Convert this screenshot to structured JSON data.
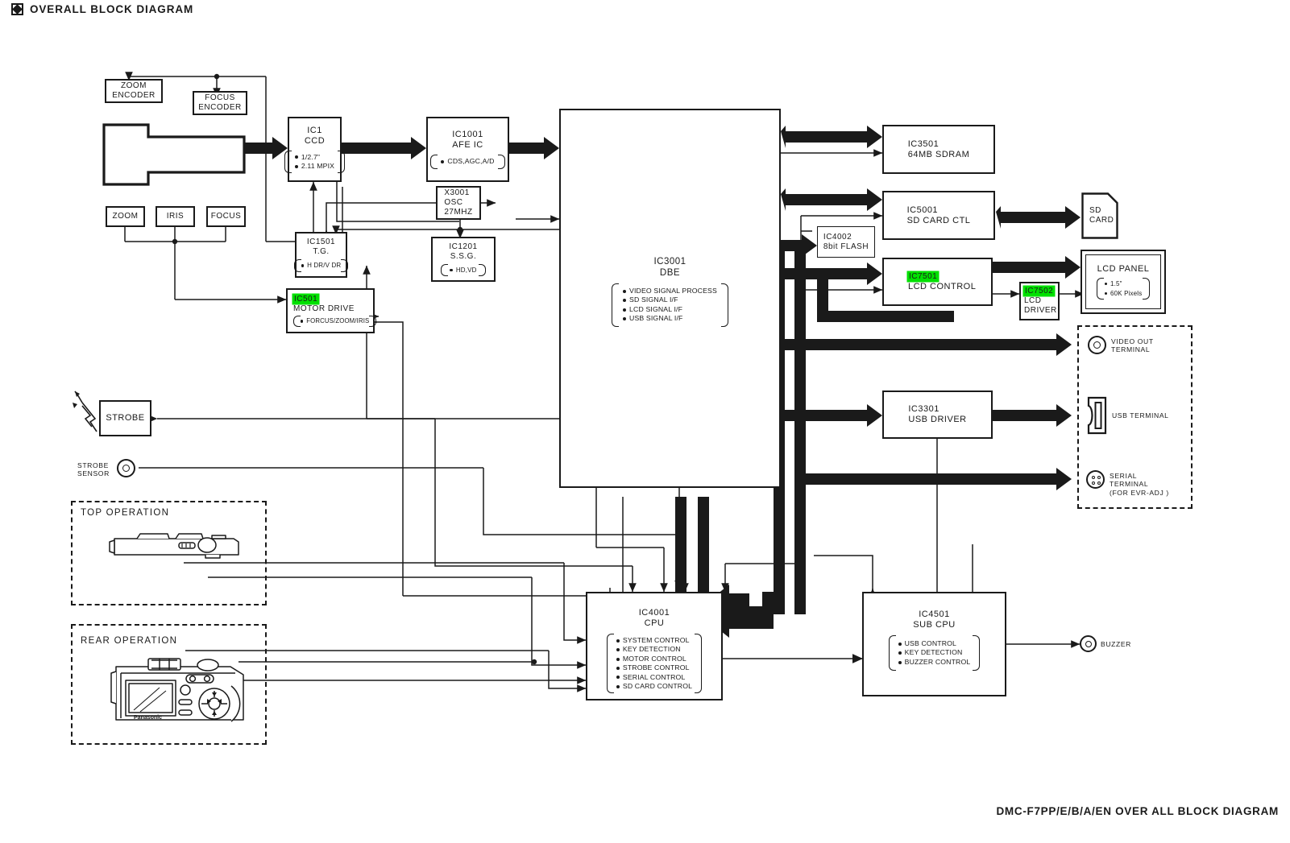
{
  "header": {
    "title": "OVERALL BLOCK DIAGRAM",
    "icon": "diamond-bullet-icon"
  },
  "footer": {
    "text": "DMC-F7PP/E/B/A/EN OVER ALL BLOCK DIAGRAM"
  },
  "colors": {
    "ink": "#1a1a1a",
    "highlight": "#00e000",
    "background": "#ffffff"
  },
  "blocks": {
    "zoom_encoder": {
      "title": "ZOOM\nENCODER"
    },
    "focus_encoder": {
      "title": "FOCUS\nENCODER"
    },
    "zoom_motor": {
      "title": "ZOOM"
    },
    "iris_motor": {
      "title": "IRIS"
    },
    "focus_motor": {
      "title": "FOCUS"
    },
    "ic1_ccd": {
      "id": "IC1",
      "name": "CCD",
      "bullets": [
        "1/2.7\"",
        "2.11 MPIX"
      ]
    },
    "ic1001_afe": {
      "id": "IC1001",
      "name": "AFE IC",
      "bullets": [
        "CDS,AGC,A/D"
      ]
    },
    "x3001_osc": {
      "title": "X3001\nOSC\n27MHZ"
    },
    "ic1501_tg": {
      "id": "IC1501",
      "name": "T.G.",
      "bullets": [
        "H DR/V DR"
      ]
    },
    "ic1201_ssg": {
      "id": "IC1201",
      "name": "S.S.G.",
      "bullets": [
        "HD,VD"
      ]
    },
    "ic501_motor": {
      "id": "IC501",
      "id_highlighted": true,
      "name": "MOTOR DRIVE",
      "bullets": [
        "FORCUS/ZOOM/IRIS"
      ]
    },
    "ic3001_dbe": {
      "id": "IC3001",
      "name": "DBE",
      "bullets": [
        "VIDEO SIGNAL PROCESS",
        "SD SIGNAL I/F",
        "LCD SIGNAL I/F",
        "USB SIGNAL I/F"
      ]
    },
    "ic3501_sdram": {
      "title": "IC3501\n64MB SDRAM"
    },
    "ic5001_sdctl": {
      "title": "IC5001\nSD CARD CTL"
    },
    "sd_card": {
      "title": "SD\nCARD"
    },
    "ic4002_flash": {
      "title": "IC4002\n8bit FLASH"
    },
    "ic7501_lcdctl": {
      "id": "IC7501",
      "id_highlighted": true,
      "name": "LCD CONTROL"
    },
    "ic7502_lcddrv": {
      "id": "IC7502",
      "id_highlighted": true,
      "name": "LCD\nDRIVER"
    },
    "lcd_panel": {
      "name": "LCD PANEL",
      "bullets": [
        "1.5\"",
        "60K Pixels"
      ]
    },
    "ic3301_usb": {
      "title": "IC3301\nUSB DRIVER"
    },
    "strobe": {
      "title": "STROBE"
    },
    "strobe_sensor": {
      "label": "STROBE\nSENSOR"
    },
    "ic4001_cpu": {
      "id": "IC4001",
      "name": "CPU",
      "bullets": [
        "SYSTEM CONTROL",
        "KEY DETECTION",
        "MOTOR CONTROL",
        "STROBE CONTROL",
        "SERIAL CONTROL",
        "SD CARD CONTROL"
      ]
    },
    "ic4501_subcpu": {
      "id": "IC4501",
      "name": "SUB CPU",
      "bullets": [
        "USB CONTROL",
        "KEY DETECTION",
        "BUZZER CONTROL"
      ]
    },
    "buzzer": {
      "label": "BUZZER"
    }
  },
  "terminals": {
    "video_out": {
      "label": "VIDEO OUT\nTERMINAL",
      "icon": "rca-jack-icon"
    },
    "usb": {
      "label": "USB TERMINAL",
      "icon": "usb-port-icon"
    },
    "serial": {
      "label": "SERIAL\nTERMINAL\n(FOR EVR-ADJ )",
      "icon": "serial-jack-icon"
    }
  },
  "panels": {
    "top_operation": {
      "label": "TOP OPERATION",
      "illustration": "camera-top-view"
    },
    "rear_operation": {
      "label": "REAR OPERATION",
      "illustration": "camera-rear-view"
    },
    "terminal_group": {
      "label": ""
    }
  }
}
